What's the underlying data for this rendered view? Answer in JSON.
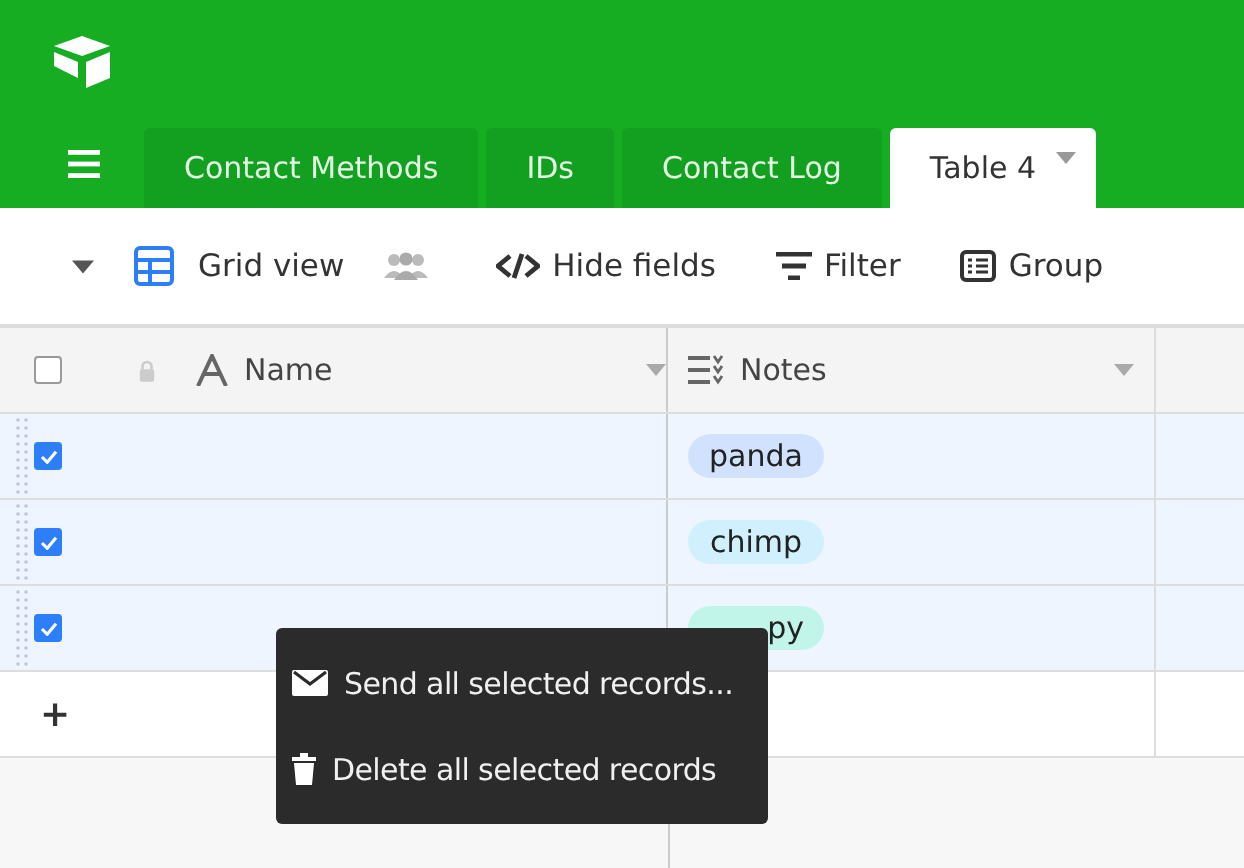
{
  "tabs": [
    {
      "label": "Contact Methods",
      "selected": false
    },
    {
      "label": "IDs",
      "selected": false
    },
    {
      "label": "Contact Log",
      "selected": false
    },
    {
      "label": "Table 4",
      "selected": true
    }
  ],
  "toolbar": {
    "view": "Grid view",
    "actions": [
      {
        "kind": "hide",
        "label": "Hide fields"
      },
      {
        "kind": "filter",
        "label": "Filter"
      },
      {
        "kind": "group",
        "label": "Group"
      }
    ]
  },
  "table": {
    "columns": [
      {
        "kind": "text",
        "label": "Name"
      },
      {
        "kind": "notes",
        "label": "Notes"
      }
    ],
    "rows": [
      {
        "checked": true,
        "note": {
          "text": "panda",
          "color": "#d1e2ff",
          "covered": false
        }
      },
      {
        "checked": true,
        "note": {
          "text": "chimp",
          "color": "#d0f0fd",
          "covered": false
        }
      },
      {
        "checked": true,
        "note": {
          "text": "py",
          "color": "#c2f5e9",
          "covered": true
        }
      }
    ],
    "all_checked": false,
    "add": "+"
  },
  "menu": [
    {
      "kind": "send",
      "label": "Send all selected records..."
    },
    {
      "kind": "delete",
      "label": "Delete all selected records"
    }
  ]
}
